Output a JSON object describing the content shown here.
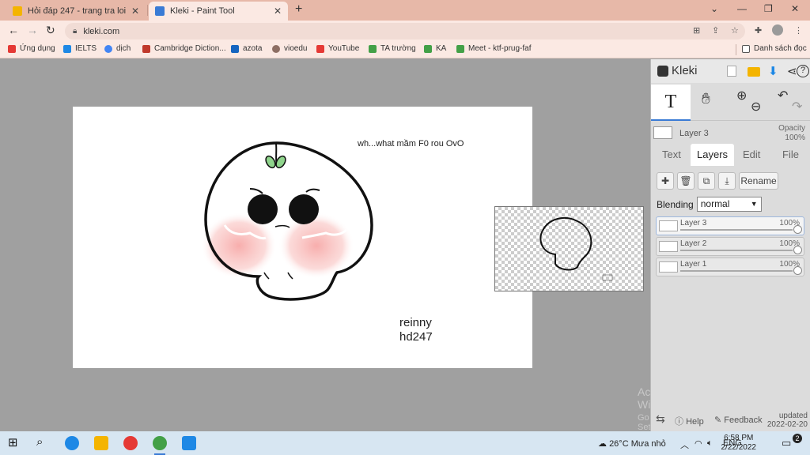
{
  "browser": {
    "tabs": [
      {
        "title": "Hỏi đáp 247 - trang tra loi",
        "active": false
      },
      {
        "title": "Kleki - Paint Tool",
        "active": true
      }
    ],
    "new_tab": "+",
    "window_controls": {
      "minimize": "⌄",
      "restore": "—",
      "maximize": "❐",
      "close": "✕"
    },
    "url": "kleki.com",
    "bookmarks": [
      {
        "label": "Ứng dụng",
        "color": "#e53935"
      },
      {
        "label": "IELTS",
        "color": "#1e88e5"
      },
      {
        "label": "dịch",
        "color": "#4285f4"
      },
      {
        "label": "Cambridge Diction...",
        "color": "#c0392b"
      },
      {
        "label": "azota",
        "color": "#1565c0"
      },
      {
        "label": "vioedu",
        "color": "#8d6e63"
      },
      {
        "label": "YouTube",
        "color": "#e53935"
      },
      {
        "label": "TA trường",
        "color": "#43a047"
      },
      {
        "label": "KA",
        "color": "#43a047"
      },
      {
        "label": "Meet - ktf-prug-faf",
        "color": "#43a047"
      }
    ],
    "reading_list": "Danh sách đọc"
  },
  "canvas": {
    "caption": "wh...what mầm F0 rou OvO",
    "signature_line1": "reinny",
    "signature_line2": "hd247"
  },
  "watermark": {
    "title": "Activate Windows",
    "subtitle": "Go to Settings to activate Windows."
  },
  "panel": {
    "logo": "Kleki",
    "active_tool": "T",
    "current_layer": "Layer 3",
    "opacity_label_1": "Opacity",
    "opacity_label_2": "100%",
    "tabs": [
      "Text",
      "Layers",
      "Edit",
      "File"
    ],
    "active_tab": "Layers",
    "rename_label": "Rename",
    "blending_label": "Blending",
    "blending_value": "normal",
    "layers": [
      {
        "name": "Layer 3",
        "opacity": "100%",
        "active": true
      },
      {
        "name": "Layer 2",
        "opacity": "100%",
        "active": false
      },
      {
        "name": "Layer 1",
        "opacity": "100%",
        "active": false
      }
    ],
    "help_label": "Help",
    "feedback_label": "Feedback",
    "updated_line1": "updated",
    "updated_line2": "2022-02-20"
  },
  "taskbar": {
    "weather": "26°C  Mưa nhỏ",
    "language": "ENG",
    "time": "6:58 PM",
    "date": "2/22/2022",
    "notification_count": "2"
  },
  "colors": {
    "tabbar": "#e7b8a8",
    "toolbar": "#fbe9e3",
    "workspace": "#a0a0a0",
    "blush": "#f7a9a8",
    "sprout": "#8fd48c",
    "accent": "#3a7bd5"
  }
}
